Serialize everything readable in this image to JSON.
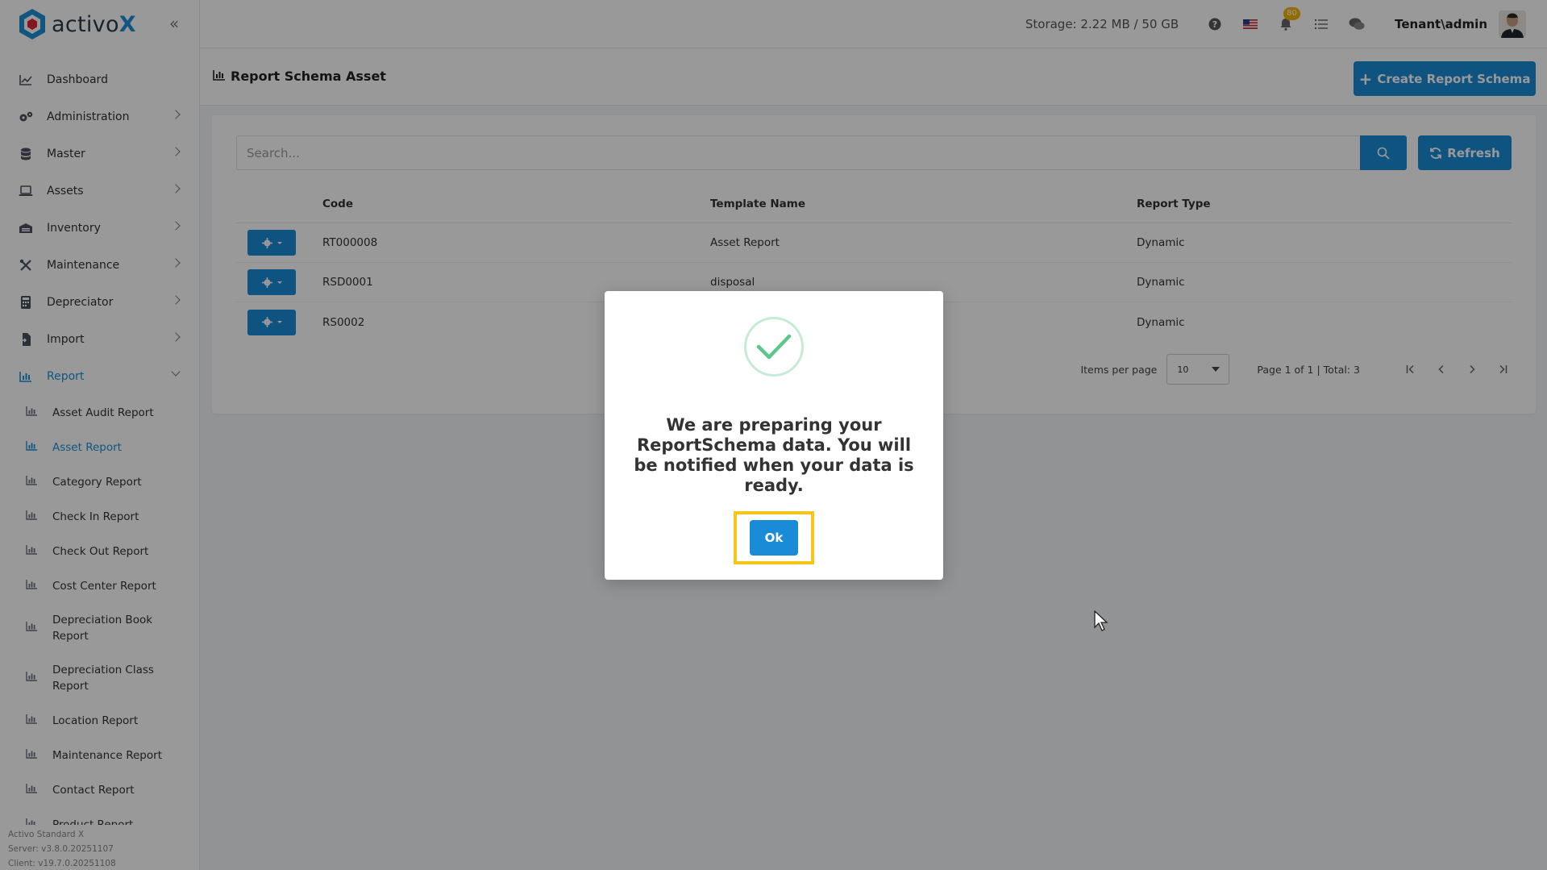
{
  "app": {
    "brand_name": "activo",
    "brand_x": "X",
    "storage": "Storage: 2.22 MB / 50 GB",
    "notification_count": "80",
    "user": "Tenant\\admin"
  },
  "sidebar": {
    "items": [
      {
        "label": "Dashboard",
        "icon": "chart-line-icon"
      },
      {
        "label": "Administration",
        "icon": "cogs-icon"
      },
      {
        "label": "Master",
        "icon": "database-icon"
      },
      {
        "label": "Assets",
        "icon": "laptop-icon"
      },
      {
        "label": "Inventory",
        "icon": "warehouse-icon"
      },
      {
        "label": "Maintenance",
        "icon": "tools-icon"
      },
      {
        "label": "Depreciator",
        "icon": "calculator-icon"
      },
      {
        "label": "Import",
        "icon": "file-import-icon"
      },
      {
        "label": "Report",
        "icon": "chart-bar-icon"
      }
    ],
    "report_sub_items": [
      "Asset Audit Report",
      "Asset Report",
      "Category Report",
      "Check In Report",
      "Check Out Report",
      "Cost Center Report",
      "Depreciation Book Report",
      "Depreciation Class Report",
      "Location Report",
      "Maintenance Report",
      "Contact Report",
      "Product Report"
    ],
    "version": {
      "edition": "Activo Standard X",
      "server": "Server: v3.8.0.20251107",
      "client": "Client: v19.7.0.20251108"
    }
  },
  "page": {
    "title": "Report Schema Asset",
    "create_label": "Create Report Schema",
    "search_placeholder": "Search...",
    "refresh_label": "Refresh"
  },
  "table": {
    "headers": {
      "code": "Code",
      "template": "Template Name",
      "type": "Report Type"
    },
    "rows": [
      {
        "code": "RT000008",
        "template": "Asset Report",
        "type": "Dynamic"
      },
      {
        "code": "RSD0001",
        "template": "disposal",
        "type": "Dynamic"
      },
      {
        "code": "RS0002",
        "template": "",
        "type": "Dynamic"
      }
    ]
  },
  "pager": {
    "items_per_page_label": "Items per page",
    "items_per_page": "10",
    "page_info": "Page 1 of 1 | Total: 3"
  },
  "modal": {
    "message": "We are preparing your ReportSchema data. You will be notified when your data is ready.",
    "ok_label": "Ok"
  },
  "colors": {
    "primary": "#1a8bd6",
    "success": "#5cc78a",
    "highlight": "#f5c518",
    "badge": "#f5b400"
  }
}
